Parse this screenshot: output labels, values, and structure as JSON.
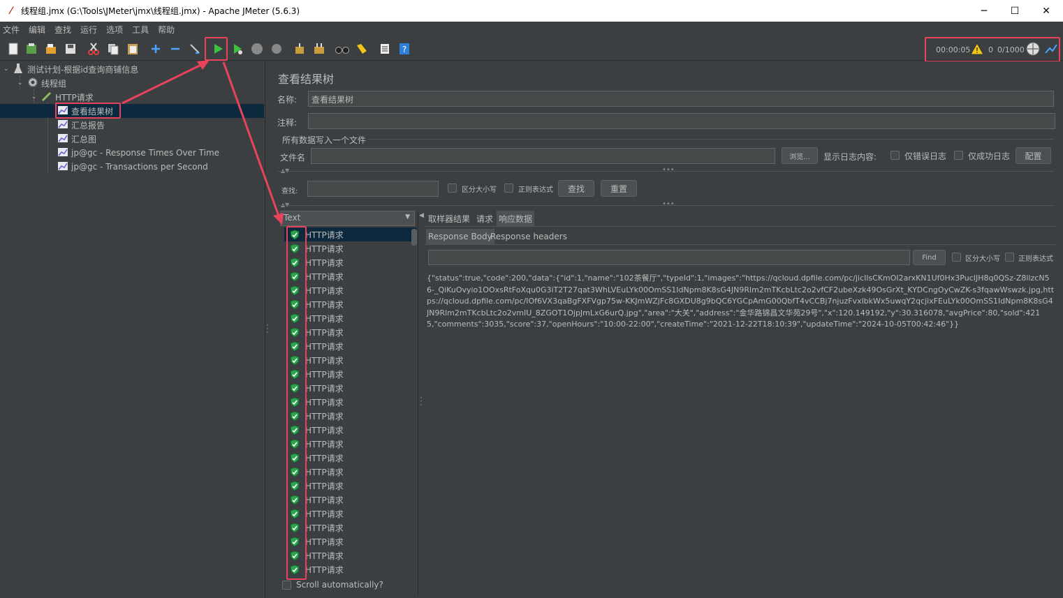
{
  "window": {
    "title": "线程组.jmx (G:\\Tools\\JMeter\\jmx\\线程组.jmx) - Apache JMeter (5.6.3)",
    "minimize": "─",
    "maximize": "☐",
    "close": "✕"
  },
  "menu": [
    "文件",
    "编辑",
    "查找",
    "运行",
    "选项",
    "工具",
    "帮助"
  ],
  "toolbar_status": {
    "elapsed": "00:00:05",
    "warnings": "0",
    "threads": "0/1000"
  },
  "tree": {
    "plan": "测试计划-根据id查询商铺信息",
    "thread_group": "线程组",
    "http": "HTTP请求",
    "listeners": [
      "查看结果树",
      "汇总报告",
      "汇总图",
      "jp@gc - Response Times Over Time",
      "jp@gc - Transactions per Second"
    ]
  },
  "panel": {
    "title": "查看结果树",
    "name_label": "名称:",
    "name_value": "查看结果树",
    "comment_label": "注释:",
    "comment_value": "",
    "file_section": "所有数据写入一个文件",
    "filename_label": "文件名",
    "browse": "浏览...",
    "log_label": "显示日志内容:",
    "errors_only": "仅错误日志",
    "success_only": "仅成功日志",
    "configure": "配置",
    "search_label": "查找:",
    "case_sensitive": "区分大小写",
    "regex": "正则表达式",
    "search_btn": "查找",
    "reset_btn": "重置"
  },
  "results": {
    "renderer": "Text",
    "items": [
      "HTTP请求",
      "HTTP请求",
      "HTTP请求",
      "HTTP请求",
      "HTTP请求",
      "HTTP请求",
      "HTTP请求",
      "HTTP请求",
      "HTTP请求",
      "HTTP请求",
      "HTTP请求",
      "HTTP请求",
      "HTTP请求",
      "HTTP请求",
      "HTTP请求",
      "HTTP请求",
      "HTTP请求",
      "HTTP请求",
      "HTTP请求",
      "HTTP请求",
      "HTTP请求",
      "HTTP请求",
      "HTTP请求",
      "HTTP请求",
      "HTTP请求"
    ],
    "scroll_auto": "Scroll automatically?"
  },
  "tabs": [
    "取样器结果",
    "请求",
    "响应数据"
  ],
  "subtabs": [
    "Response Body",
    "Response headers"
  ],
  "find": {
    "button": "Find",
    "case": "区分大小写",
    "regex": "正则表达式"
  },
  "response_body": "{\"status\":true,\"code\":200,\"data\":{\"id\":1,\"name\":\"102茶餐厅\",\"typeId\":1,\"images\":\"https://qcloud.dpfile.com/pc/jicIlsCKmOI2arxKN1Uf0Hx3PucIJH8q0QSz-Z8llzcN56-_QiKuOvyio1OOxsRtFoXqu0G3iT2T27qat3WhLVEuLYk00OmSS1IdNpm8K8sG4JN9Rlm2mTKcbLtc2o2vfCF2ubeXzk49OsGrXt_KYDCngOyCwZK-s3fqawWswzk.jpg,https://qcloud.dpfile.com/pc/IOf6VX3qaBgFXFVgp75w-KKJmWZjFc8GXDU8g9bQC6YGCpAmG00QbfT4vCCBj7njuzFvxlbkWx5uwqY2qcjixFEuLYk00OmSS1IdNpm8K8sG4JN9Rlm2mTKcbLtc2o2vmIU_8ZGOT1OjpJmLxG6urQ.jpg\",\"area\":\"大关\",\"address\":\"金华路锦昌文华苑29号\",\"x\":120.149192,\"y\":30.316078,\"avgPrice\":80,\"sold\":4215,\"comments\":3035,\"score\":37,\"openHours\":\"10:00-22:00\",\"createTime\":\"2021-12-22T18:10:39\",\"updateTime\":\"2024-10-05T00:42:46\"}}"
}
